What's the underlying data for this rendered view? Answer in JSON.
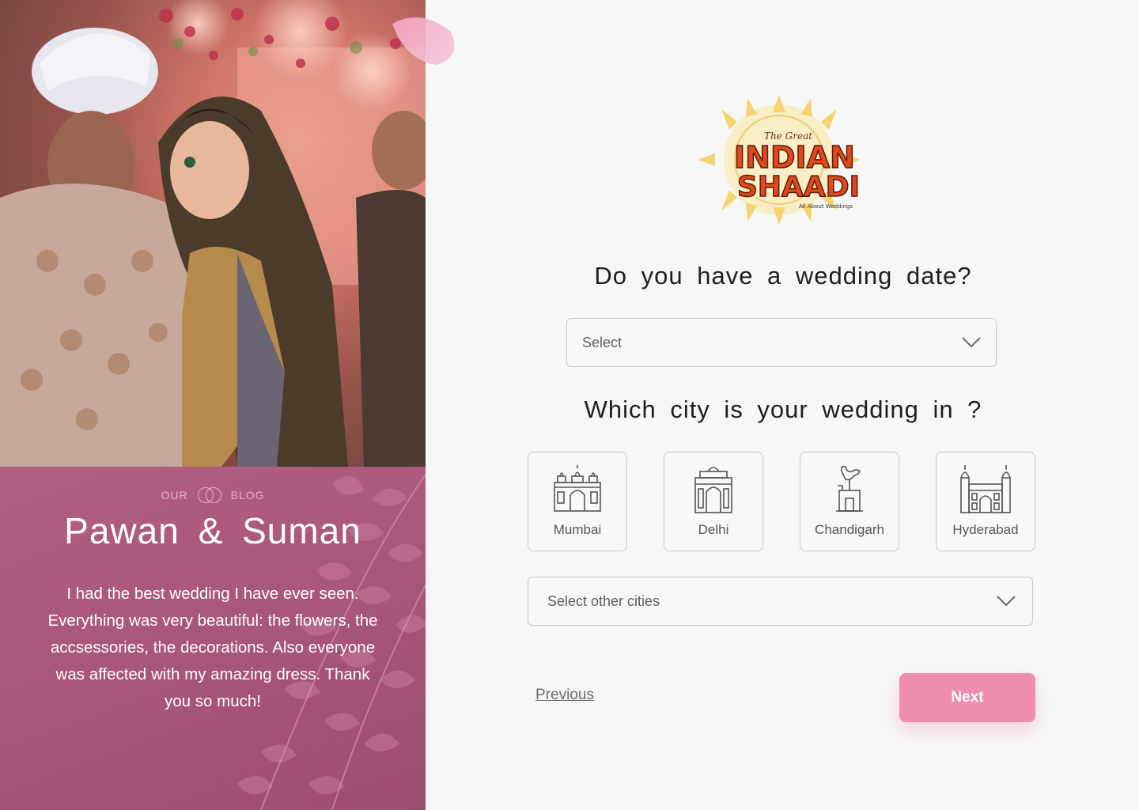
{
  "testimonial": {
    "tag_left": "OUR",
    "tag_right": "BLOG",
    "couple_name": "Pawan & Suman",
    "quote": "I had the best wedding I have ever seen. Everything was very beautiful: the flowers, the accsessories, the decorations. Also everyone was affected with my amazing dress. Thank you so much!"
  },
  "logo": {
    "line1": "The Great",
    "line2": "INDIAN",
    "line3": "SHAADI",
    "tagline": "All About Weddings"
  },
  "date_question": "Do you have a wedding date?",
  "date_select": {
    "value": "Select"
  },
  "city_question": "Which city is your wedding in ?",
  "cities": [
    {
      "label": "Mumbai",
      "icon": "gateway-of-india-icon"
    },
    {
      "label": "Delhi",
      "icon": "india-gate-icon"
    },
    {
      "label": "Chandigarh",
      "icon": "open-hand-monument-icon"
    },
    {
      "label": "Hyderabad",
      "icon": "charminar-icon"
    }
  ],
  "other_cities_select": {
    "value": "Select other cities"
  },
  "nav": {
    "previous_label": "Previous",
    "next_label": "Next"
  },
  "colors": {
    "accent": "#ef8db0",
    "blog_panel": "#a65479"
  }
}
